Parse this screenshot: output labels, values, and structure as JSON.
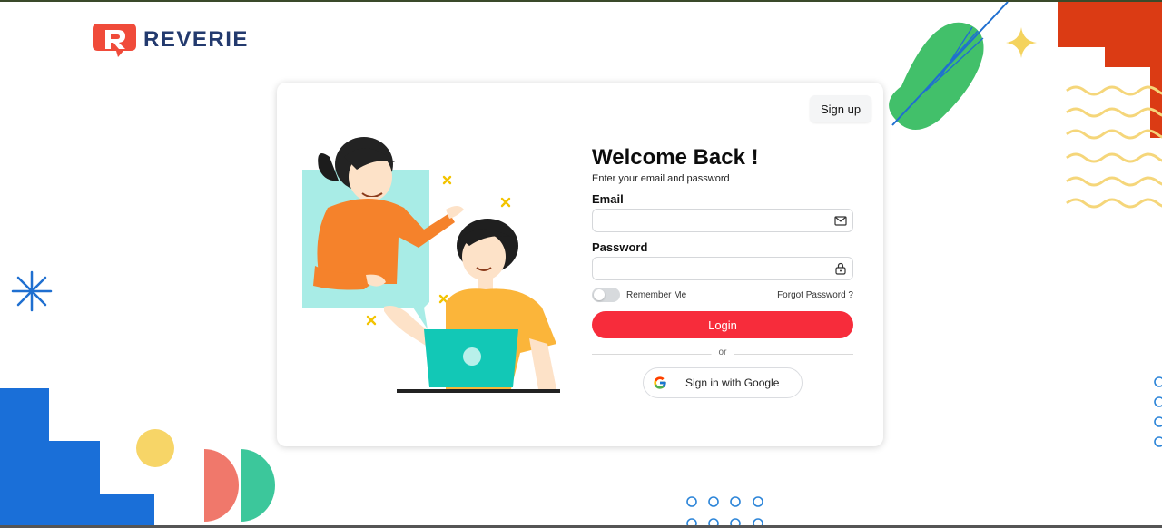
{
  "brand": {
    "name": "REVERIE",
    "accent": "#f72c3b",
    "navy": "#233a6e"
  },
  "header": {
    "signup_label": "Sign up"
  },
  "form": {
    "title": "Welcome Back !",
    "subtitle": "Enter your email and password",
    "email_label": "Email",
    "email_value": "",
    "email_icon": "mail-icon",
    "password_label": "Password",
    "password_value": "",
    "password_icon": "lock-icon",
    "remember_label": "Remember Me",
    "remember_checked": false,
    "forgot_label": "Forgot Password ?",
    "login_label": "Login",
    "divider_label": "or",
    "google_label": "Sign in with Google"
  }
}
